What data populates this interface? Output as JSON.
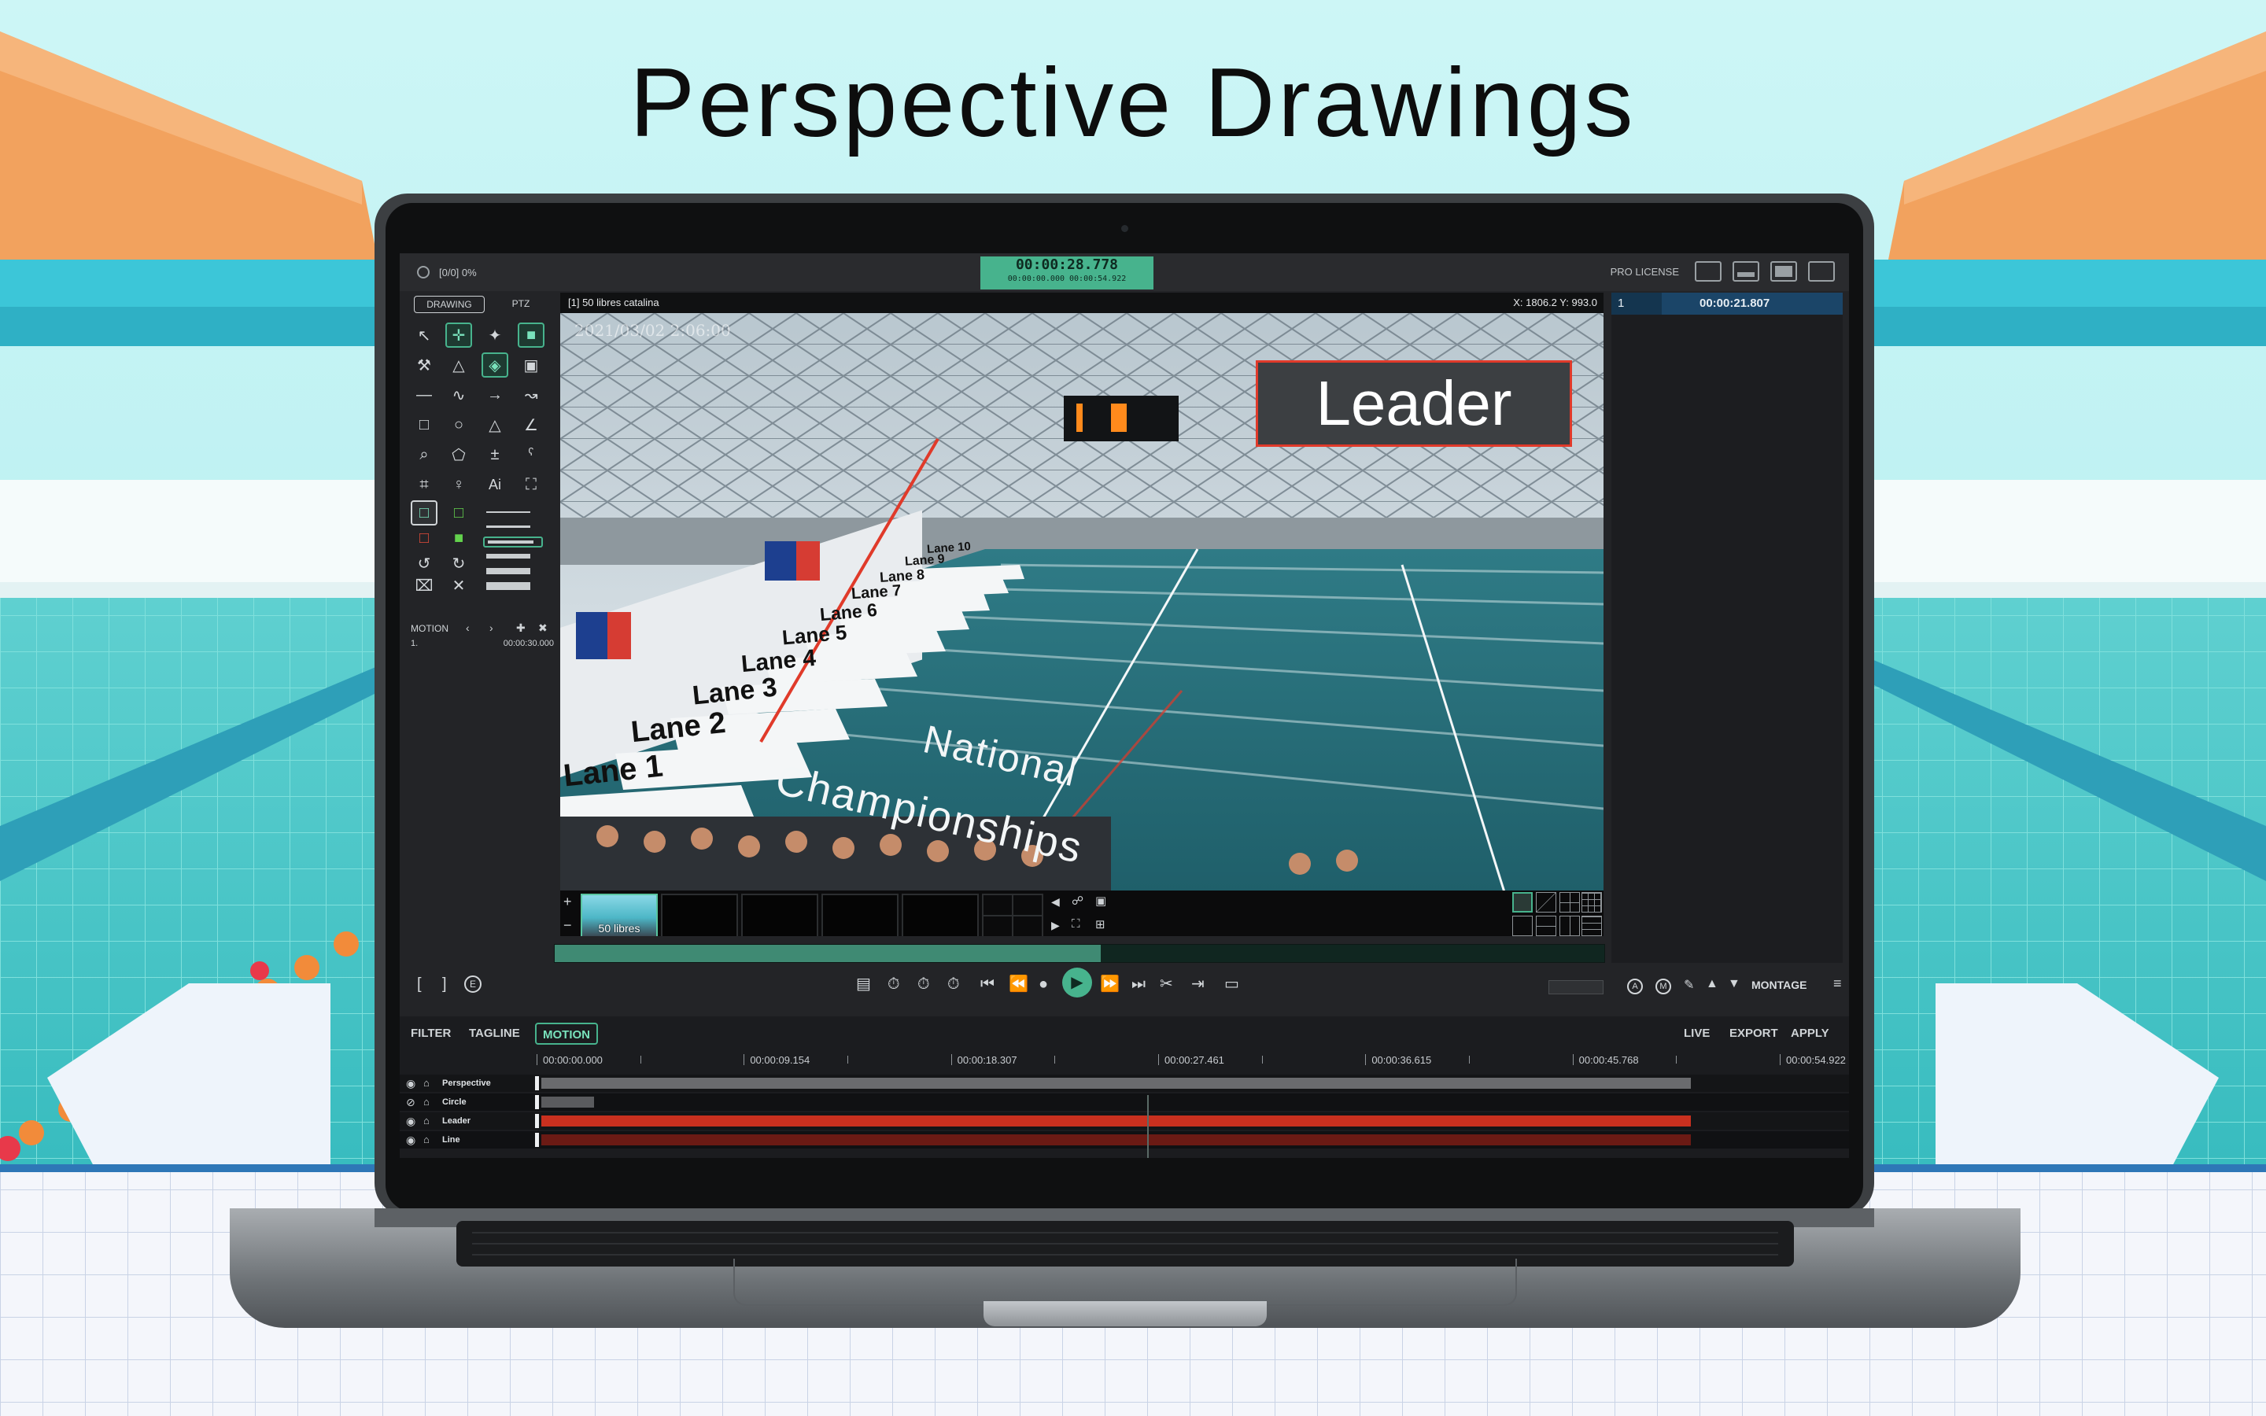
{
  "headline": "Perspective Drawings",
  "app": {
    "status": "[0/0] 0%",
    "timer_main": "00:00:28.778",
    "timer_sub": "00:00:00.000   00:00:54.922",
    "license": "PRO LICENSE"
  },
  "tools": {
    "tab_drawing": "DRAWING",
    "tab_ptz": "PTZ",
    "motion_label": "MOTION",
    "motion_row_index": "1.",
    "motion_row_time": "00:00:30.000",
    "ai_label": "Ai"
  },
  "video": {
    "title": "[1] 50 libres catalina",
    "coords": "X: 1806.2  Y: 993.0",
    "timestamp": "2021/03/02 2:06:00",
    "leader_label": "Leader",
    "championship_line1": "National",
    "championship_line2": "Championships",
    "lanes": [
      "Lane 1",
      "Lane 2",
      "Lane 3",
      "Lane 4",
      "Lane 5",
      "Lane 6",
      "Lane 7",
      "Lane 8",
      "Lane 9",
      "Lane 10"
    ],
    "thumb_label": "50 libres",
    "progress": 0.52
  },
  "right_panel": {
    "clip_index": "1",
    "clip_time": "00:00:21.807",
    "montage": "MONTAGE"
  },
  "bottom": {
    "tabs": [
      "FILTER",
      "TAGLINE",
      "MOTION"
    ],
    "actions": [
      "LIVE",
      "EXPORT",
      "APPLY"
    ],
    "ruler": [
      "00:00:00.000",
      "00:00:09.154",
      "00:00:18.307",
      "00:00:27.461",
      "00:00:36.615",
      "00:00:45.768",
      "00:00:54.922"
    ],
    "tracks": [
      {
        "name": "Perspective",
        "color": "#6a6b6e",
        "start": 0.0,
        "end": 0.986
      },
      {
        "name": "Circle",
        "color": "#5a5b5e",
        "start": 0.0,
        "end": 0.045
      },
      {
        "name": "Leader",
        "color": "#c9301f",
        "start": 0.0,
        "end": 0.986
      },
      {
        "name": "Line",
        "color": "#6b1a14",
        "start": 0.0,
        "end": 0.986
      }
    ]
  },
  "colors": {
    "accent": "#47b38d",
    "leader_red": "#e03a2a",
    "clip_blue": "#1b4568"
  }
}
